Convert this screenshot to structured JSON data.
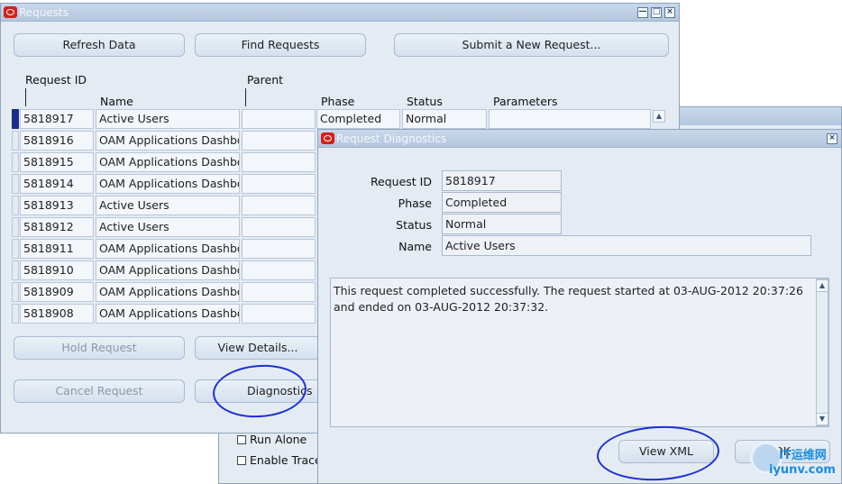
{
  "requests_window": {
    "title": "Requests",
    "buttons": {
      "refresh": "Refresh Data",
      "find": "Find Requests",
      "submit": "Submit a New Request...",
      "hold": "Hold Request",
      "view_details": "View Details...",
      "cancel": "Cancel Request",
      "diagnostics": "Diagnostics"
    },
    "columns": {
      "request_id": "Request ID",
      "name": "Name",
      "parent": "Parent",
      "phase": "Phase",
      "status": "Status",
      "parameters": "Parameters"
    },
    "rows": [
      {
        "id": "5818917",
        "name": "Active Users",
        "phase": "Completed",
        "status": "Normal"
      },
      {
        "id": "5818916",
        "name": "OAM Applications Dashboard"
      },
      {
        "id": "5818915",
        "name": "OAM Applications Dashboard"
      },
      {
        "id": "5818914",
        "name": "OAM Applications Dashboard"
      },
      {
        "id": "5818913",
        "name": "Active Users"
      },
      {
        "id": "5818912",
        "name": "Active Users"
      },
      {
        "id": "5818911",
        "name": "OAM Applications Dashboard"
      },
      {
        "id": "5818910",
        "name": "OAM Applications Dashboard"
      },
      {
        "id": "5818909",
        "name": "OAM Applications Dashboard"
      },
      {
        "id": "5818908",
        "name": "OAM Applications Dashboard"
      }
    ]
  },
  "background_window": {
    "run_alone": "Run Alone",
    "enable_trace": "Enable Trace"
  },
  "diagnostics_dialog": {
    "title": "Request Diagnostics",
    "labels": {
      "request_id": "Request ID",
      "phase": "Phase",
      "status": "Status",
      "name": "Name"
    },
    "values": {
      "request_id": "5818917",
      "phase": "Completed",
      "status": "Normal",
      "name": "Active Users"
    },
    "message": "This request completed successfully. The request started at 03-AUG-2012 20:37:26 and ended on 03-AUG-2012 20:37:32.",
    "buttons": {
      "view_xml": "View XML",
      "ok": "OK"
    }
  },
  "watermark": "iyunv.com",
  "watermark_cn": "IT运维网",
  "colors": {
    "window_bg": "#e4ebf3",
    "title_bar": "#b4c7df",
    "annotation": "#1b2fd6",
    "oracle_red": "#d3221b",
    "selected_row": "#1a2f8a"
  }
}
